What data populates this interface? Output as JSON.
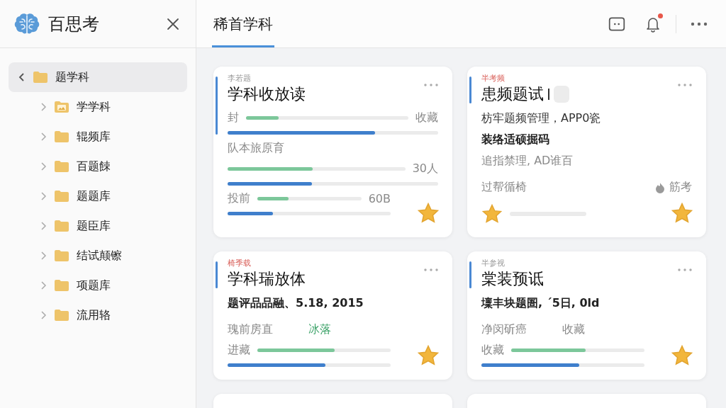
{
  "sidebar": {
    "app_name": "百思考",
    "tree": [
      {
        "label": "题学科",
        "kind": "folder",
        "expanded": true,
        "selected": true,
        "children": [
          {
            "label": "学学科",
            "kind": "image-folder",
            "expanded": false,
            "selected": false
          },
          {
            "label": "辊频库",
            "kind": "folder",
            "expanded": false,
            "selected": false
          },
          {
            "label": "百题餗",
            "kind": "folder",
            "expanded": false,
            "selected": false
          },
          {
            "label": "题题库",
            "kind": "folder",
            "expanded": false,
            "selected": false
          },
          {
            "label": "题臣库",
            "kind": "folder",
            "expanded": false,
            "selected": false
          },
          {
            "label": "结试颠镲",
            "kind": "folder",
            "expanded": false,
            "selected": false
          },
          {
            "label": "项题库",
            "kind": "folder",
            "expanded": false,
            "selected": false
          },
          {
            "label": "流用辂",
            "kind": "folder",
            "expanded": false,
            "selected": false
          }
        ]
      }
    ]
  },
  "header": {
    "tabs": [
      {
        "label": "稀首学科",
        "selected": true
      }
    ],
    "notification": true
  },
  "cards": [
    {
      "kind": "normal",
      "tag": {
        "text": "李若题",
        "color": "#9a9a9a"
      },
      "title": "学科收放读",
      "starred": true,
      "lines": [
        {
          "kind": "meter",
          "label": "封",
          "level": 0.2,
          "value": "收藏"
        },
        {
          "kind": "progress",
          "level": 0.7
        },
        {
          "kind": "muted-text",
          "text": "队本旅原育"
        },
        {
          "kind": "meter",
          "level": 0.48,
          "value": "30人"
        },
        {
          "kind": "progress",
          "level": 0.4
        },
        {
          "kind": "short-meter",
          "label": "投前",
          "level": 0.3,
          "value": "60B"
        },
        {
          "kind": "short-progress",
          "level": 0.28
        }
      ]
    },
    {
      "kind": "editing",
      "tag": {
        "text": "半考频",
        "color": "#d9605a"
      },
      "title": "患频题试",
      "starred": true,
      "lines": [
        {
          "kind": "text",
          "text": "枋牢题频管理，APP0瓷"
        },
        {
          "kind": "strong-text",
          "text": "装络适硕掘码"
        },
        {
          "kind": "muted-text",
          "text": "追指禁理, AD谁百"
        },
        {
          "kind": "hot-pair",
          "text": "过帮循椅",
          "value": "筋考"
        },
        {
          "kind": "star-track",
          "starred": true
        }
      ]
    },
    {
      "kind": "normal",
      "tag": {
        "text": "椅季载",
        "color": "#d9605a"
      },
      "title": "学科瑞放体",
      "starred": true,
      "lines": [
        {
          "kind": "strong-text",
          "text": "题评品品融、5.18, 2015"
        },
        {
          "kind": "highlight-pair",
          "text": "瑰前房直",
          "value": "冰落"
        },
        {
          "kind": "short-meter",
          "label": "进藏",
          "level": 0.58
        },
        {
          "kind": "short-progress",
          "level": 0.6
        }
      ]
    },
    {
      "kind": "normal",
      "tag": {
        "text": "半参视",
        "color": "#9a9a9a"
      },
      "title": "棠装预诋",
      "starred": true,
      "lines": [
        {
          "kind": "strong-text",
          "text": "壈丰块题圄, ˊ5日, 0ld"
        },
        {
          "kind": "label-pair",
          "text": "净闵斫癌",
          "value": "收藏"
        },
        {
          "kind": "short-meter",
          "label": "收藏",
          "level": 0.56
        },
        {
          "kind": "short-progress",
          "level": 0.6
        }
      ]
    },
    {
      "kind": "partial"
    },
    {
      "kind": "partial"
    }
  ]
}
